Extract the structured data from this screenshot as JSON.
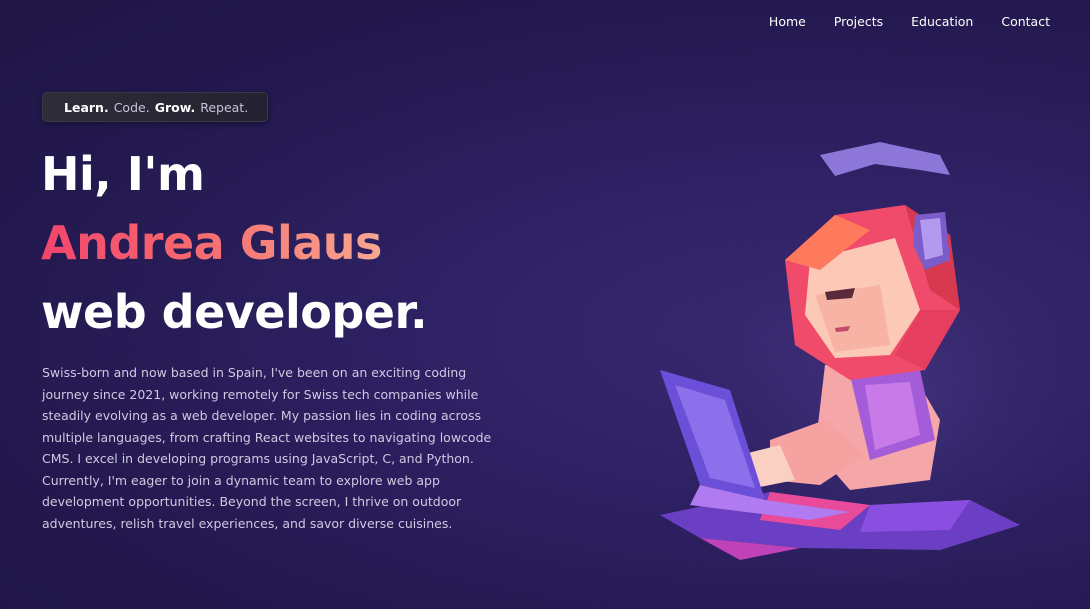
{
  "nav": {
    "items": [
      {
        "label": "Home"
      },
      {
        "label": "Projects"
      },
      {
        "label": "Education"
      },
      {
        "label": "Contact"
      }
    ]
  },
  "tagline": {
    "learn": "Learn.",
    "code": "Code.",
    "grow": "Grow.",
    "repeat": "Repeat."
  },
  "hero": {
    "greeting": "Hi, I'm",
    "name": "Andrea Glaus",
    "role": "web developer.",
    "bio": "Swiss-born and now based in Spain, I've been on an exciting coding journey since 2021, working remotely for Swiss tech companies while steadily evolving as a web developer. My passion lies in coding across multiple languages, from crafting React websites to navigating lowcode CMS. I excel in developing programs using JavaScript, C, and Python. Currently, I'm eager to join a dynamic team to explore web app development opportunities. Beyond the screen, I thrive on outdoor adventures, relish travel experiences, and savor diverse cuisines."
  },
  "colors": {
    "background": "#2a1e5c",
    "name_gradient_start": "#f2456d",
    "name_gradient_end": "#f7a890",
    "bio_text": "#cfc9e1"
  }
}
